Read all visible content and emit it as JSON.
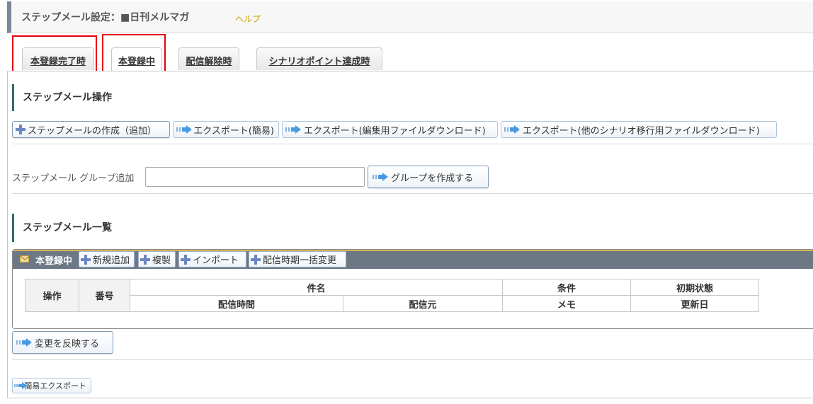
{
  "header": {
    "title": "ステップメール設定：■日刊メルマガ",
    "help_label": "ヘルプ"
  },
  "tabs": [
    {
      "label": "本登録完了時"
    },
    {
      "label": "本登録中",
      "active": true
    },
    {
      "label": "配信解除時"
    },
    {
      "label": "シナリオポイント達成時"
    }
  ],
  "operations": {
    "title": "ステップメール操作",
    "buttons": [
      {
        "label": "ステップメールの作成（追加）",
        "icon": "plus-icon"
      },
      {
        "label": "エクスポート(簡易)",
        "icon": "arrow-right-icon"
      },
      {
        "label": "エクスポート(編集用ファイルダウンロード)",
        "icon": "arrow-right-icon"
      },
      {
        "label": "エクスポート(他のシナリオ移行用ファイルダウンロード)",
        "icon": "arrow-right-icon"
      }
    ]
  },
  "group": {
    "label": "ステップメール グループ追加",
    "input_value": "",
    "create_button": "グループを作成する"
  },
  "list": {
    "title": "ステップメール一覧",
    "bar_label": "本登録中",
    "bar_buttons": [
      {
        "label": "新規追加"
      },
      {
        "label": "複製"
      },
      {
        "label": "インポート"
      },
      {
        "label": "配信時期一括変更"
      }
    ],
    "table": {
      "header_row1": [
        "操作",
        "番号",
        "件名",
        "条件",
        "初期状態"
      ],
      "header_row2": [
        "配信時間",
        "配信元",
        "メモ",
        "更新日"
      ]
    }
  },
  "apply_button": "変更を反映する",
  "simple_export_button": "簡易エクスポート",
  "colors": {
    "highlight": "#e60012",
    "section_accent": "#2f6b6b",
    "bar_bg": "#6c7984",
    "help_link": "#c9a000"
  }
}
